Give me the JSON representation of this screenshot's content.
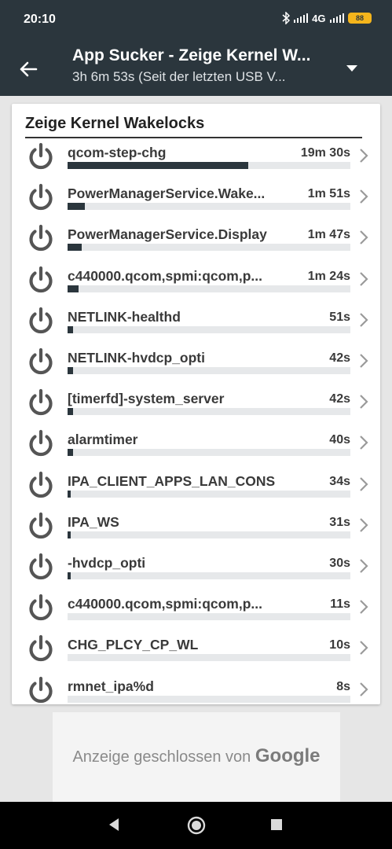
{
  "status": {
    "time": "20:10",
    "network": "4G",
    "battery": "88",
    "icons": [
      "bluetooth-icon",
      "signal-icon",
      "signal-icon-2",
      "battery-icon"
    ]
  },
  "toolbar": {
    "title": "App Sucker - Zeige Kernel W...",
    "subtitle": "3h 6m 53s (Seit der letzten USB V...",
    "back_icon": "arrow-left-icon",
    "menu_icon": "dropdown-icon"
  },
  "card": {
    "title": "Zeige Kernel Wakelocks",
    "items": [
      {
        "name": "qcom-step-chg",
        "time": "19m 30s",
        "fraction": 0.64
      },
      {
        "name": "PowerManagerService.Wake...",
        "time": "1m 51s",
        "fraction": 0.06
      },
      {
        "name": "PowerManagerService.Display",
        "time": "1m 47s",
        "fraction": 0.05
      },
      {
        "name": "c440000.qcom,spmi:qcom,p...",
        "time": "1m 24s",
        "fraction": 0.04
      },
      {
        "name": "NETLINK-healthd",
        "time": "51s",
        "fraction": 0.02
      },
      {
        "name": "NETLINK-hvdcp_opti",
        "time": "42s",
        "fraction": 0.02
      },
      {
        "name": "[timerfd]-system_server",
        "time": "42s",
        "fraction": 0.02
      },
      {
        "name": "alarmtimer",
        "time": "40s",
        "fraction": 0.02
      },
      {
        "name": "IPA_CLIENT_APPS_LAN_CONS",
        "time": "34s",
        "fraction": 0.01
      },
      {
        "name": "IPA_WS",
        "time": "31s",
        "fraction": 0.01
      },
      {
        "name": "-hvdcp_opti",
        "time": "30s",
        "fraction": 0.01
      },
      {
        "name": "c440000.qcom,spmi:qcom,p...",
        "time": "11s",
        "fraction": 0.0
      },
      {
        "name": "CHG_PLCY_CP_WL",
        "time": "10s",
        "fraction": 0.0
      },
      {
        "name": "rmnet_ipa%d",
        "time": "8s",
        "fraction": 0.0
      }
    ]
  },
  "ad": {
    "text": "Anzeige geschlossen von",
    "brand": "Google"
  },
  "navbar": {
    "icons": [
      "back-triangle-icon",
      "home-circle-icon",
      "recents-square-icon"
    ]
  },
  "colors": {
    "primary": "#2b363d",
    "battery": "#f5b51c",
    "bar_track": "#e6e8ea"
  }
}
